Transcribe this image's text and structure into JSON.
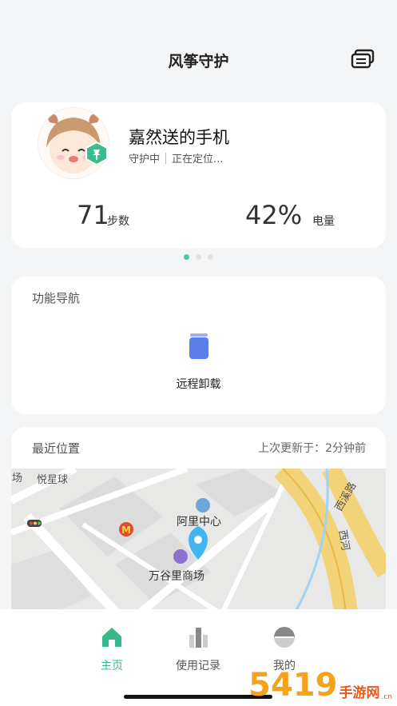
{
  "header": {
    "title": "风筝守护",
    "messages_icon": "messages-icon"
  },
  "profile": {
    "device_name": "嘉然送的手机",
    "status": "守护中",
    "location_status": "正在定位...",
    "badge_icon": "pin-shield-icon",
    "steps_value": "71",
    "steps_unit": "步数",
    "battery_value": "42%",
    "battery_unit": "电量"
  },
  "pager": {
    "count": 3,
    "active": 0
  },
  "features": {
    "title": "功能导航",
    "items": [
      {
        "label": "远程卸载",
        "icon": "trash-icon"
      }
    ]
  },
  "location": {
    "title": "最近位置",
    "updated": "上次更新于：2分钟前",
    "map_labels": {
      "poi_1": "悦星球",
      "poi_2": "阿里中心",
      "poi_3": "万谷里商场",
      "road_1": "西溪路",
      "road_2": "场",
      "road_3": "西河"
    }
  },
  "tabs": [
    {
      "label": "主页",
      "icon": "home-icon",
      "active": true
    },
    {
      "label": "使用记录",
      "icon": "usage-records-icon",
      "active": false
    },
    {
      "label": "我的",
      "icon": "profile-icon",
      "active": false
    }
  ],
  "watermark": {
    "digits": "5419",
    "text": "手游网",
    "domain": ".cn"
  },
  "colors": {
    "accent": "#37b98a",
    "pin": "#3fb6f2",
    "background": "#f4f5f6"
  }
}
